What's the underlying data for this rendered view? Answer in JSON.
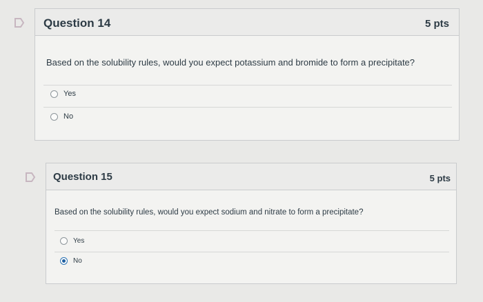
{
  "questions": [
    {
      "title": "Question 14",
      "points": "5 pts",
      "text": "Based on the solubility rules, would you expect potassium and bromide to form a precipitate?",
      "answers": [
        {
          "label": "Yes",
          "selected": false
        },
        {
          "label": "No",
          "selected": false
        }
      ]
    },
    {
      "title": "Question 15",
      "points": "5 pts",
      "text": "Based on the solubility rules, would you expect sodium and nitrate to form a precipitate?",
      "answers": [
        {
          "label": "Yes",
          "selected": false
        },
        {
          "label": "No",
          "selected": true
        }
      ]
    }
  ],
  "colors": {
    "flag": "#c7b6c0",
    "selected_radio": "#1f5fa1"
  }
}
